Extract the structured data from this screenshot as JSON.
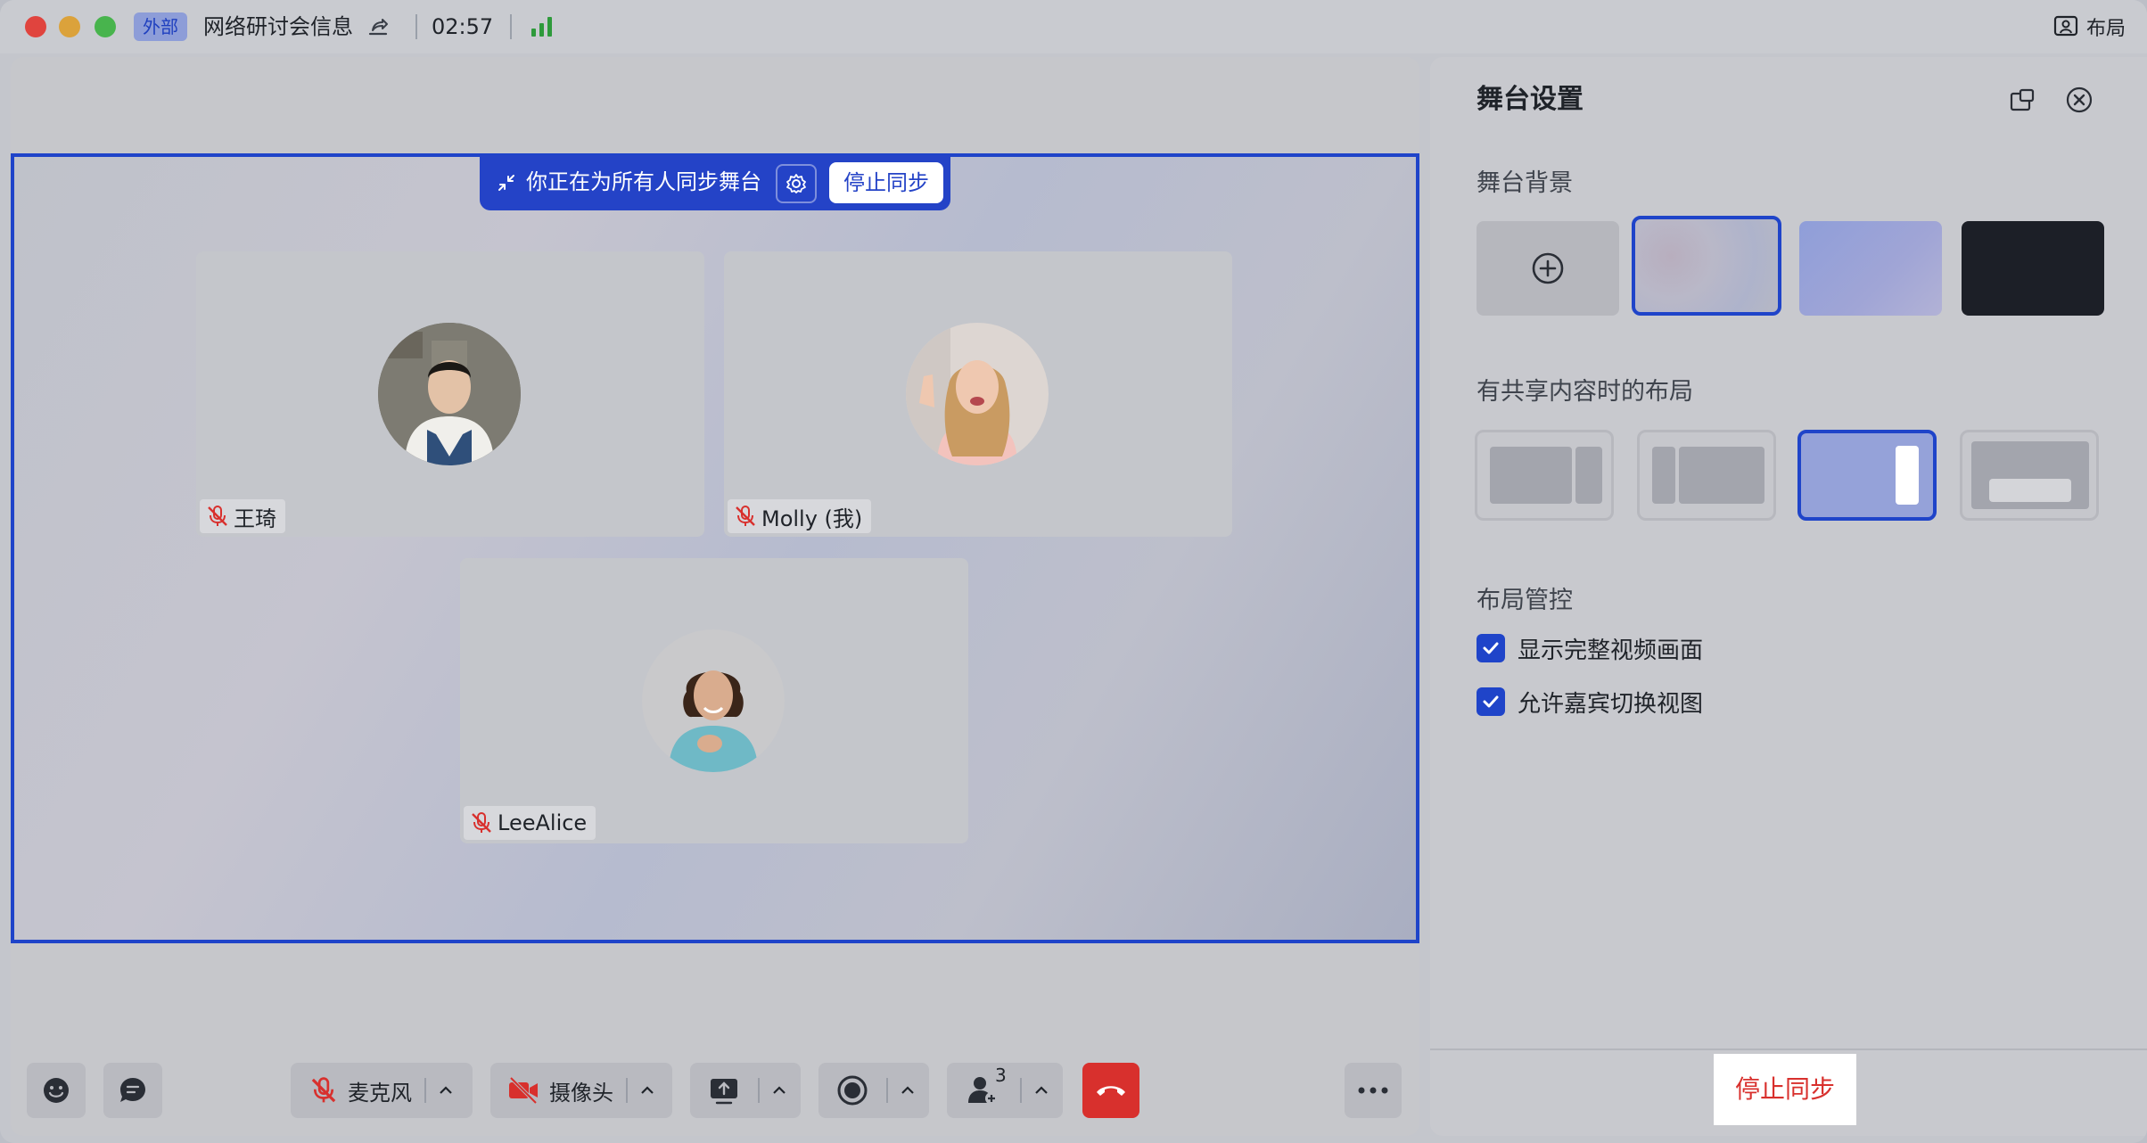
{
  "titlebar": {
    "tag": "外部",
    "meeting_title": "网络研讨会信息",
    "timer": "02:57",
    "layout_label": "布局"
  },
  "sync_banner": {
    "text": "你正在为所有人同步舞台",
    "stop_label": "停止同步"
  },
  "participants": [
    {
      "name": "王琦"
    },
    {
      "name": "Molly (我)"
    },
    {
      "name": "LeeAlice"
    }
  ],
  "toolbar": {
    "mic_label": "麦克风",
    "camera_label": "摄像头",
    "participants_count": "3"
  },
  "panel": {
    "title": "舞台设置",
    "background_label": "舞台背景",
    "layout_label": "有共享内容时的布局",
    "control_label": "布局管控",
    "checkbox_full_video": "显示完整视频画面",
    "checkbox_allow_switch": "允许嘉宾切换视图",
    "stop_label": "停止同步"
  },
  "colors": {
    "accent": "#1f44c9",
    "danger": "#d8302d"
  }
}
